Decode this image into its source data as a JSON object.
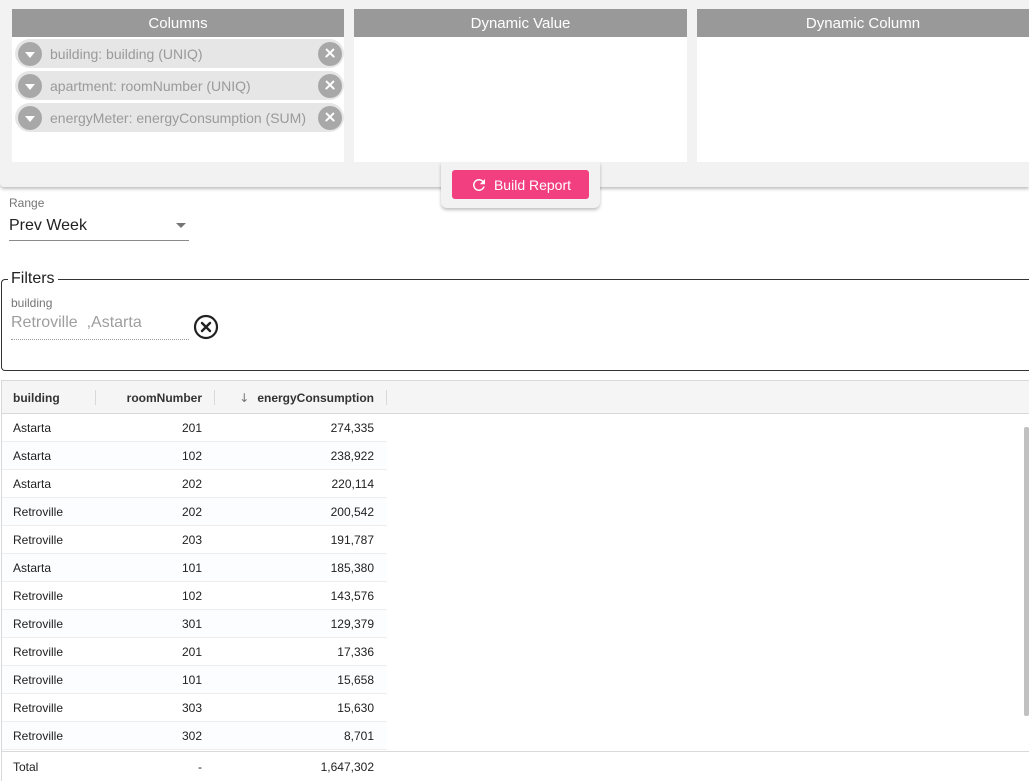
{
  "panels": {
    "columns": {
      "title": "Columns",
      "chips": [
        {
          "label": "building: building (UNIQ)"
        },
        {
          "label": "apartment: roomNumber (UNIQ)"
        },
        {
          "label": "energyMeter: energyConsumption (SUM)"
        }
      ]
    },
    "dynamic_value": {
      "title": "Dynamic Value"
    },
    "dynamic_column": {
      "title": "Dynamic Column"
    }
  },
  "build_button": {
    "label": "Build Report",
    "icon": "refresh-icon"
  },
  "range": {
    "label": "Range",
    "value": "Prev Week"
  },
  "filters": {
    "title": "Filters",
    "building": {
      "label": "building",
      "value": "Retroville  ,Astarta"
    }
  },
  "table": {
    "headers": {
      "building": "building",
      "roomNumber": "roomNumber",
      "energyConsumption": "energyConsumption",
      "sort_icon": "arrow-down-icon"
    },
    "rows": [
      {
        "building": "Astarta",
        "roomNumber": "201",
        "energyConsumption": "274,335"
      },
      {
        "building": "Astarta",
        "roomNumber": "102",
        "energyConsumption": "238,922"
      },
      {
        "building": "Astarta",
        "roomNumber": "202",
        "energyConsumption": "220,114"
      },
      {
        "building": "Retroville",
        "roomNumber": "202",
        "energyConsumption": "200,542"
      },
      {
        "building": "Retroville",
        "roomNumber": "203",
        "energyConsumption": "191,787"
      },
      {
        "building": "Astarta",
        "roomNumber": "101",
        "energyConsumption": "185,380"
      },
      {
        "building": "Retroville",
        "roomNumber": "102",
        "energyConsumption": "143,576"
      },
      {
        "building": "Retroville",
        "roomNumber": "301",
        "energyConsumption": "129,379"
      },
      {
        "building": "Retroville",
        "roomNumber": "201",
        "energyConsumption": "17,336"
      },
      {
        "building": "Retroville",
        "roomNumber": "101",
        "energyConsumption": "15,658"
      },
      {
        "building": "Retroville",
        "roomNumber": "303",
        "energyConsumption": "15,630"
      },
      {
        "building": "Retroville",
        "roomNumber": "302",
        "energyConsumption": "8,701"
      }
    ],
    "total": {
      "label": "Total",
      "roomNumber": "-",
      "energyConsumption": "1,647,302"
    }
  },
  "colors": {
    "accent": "#f23f7f",
    "panel_header": "#999999"
  }
}
